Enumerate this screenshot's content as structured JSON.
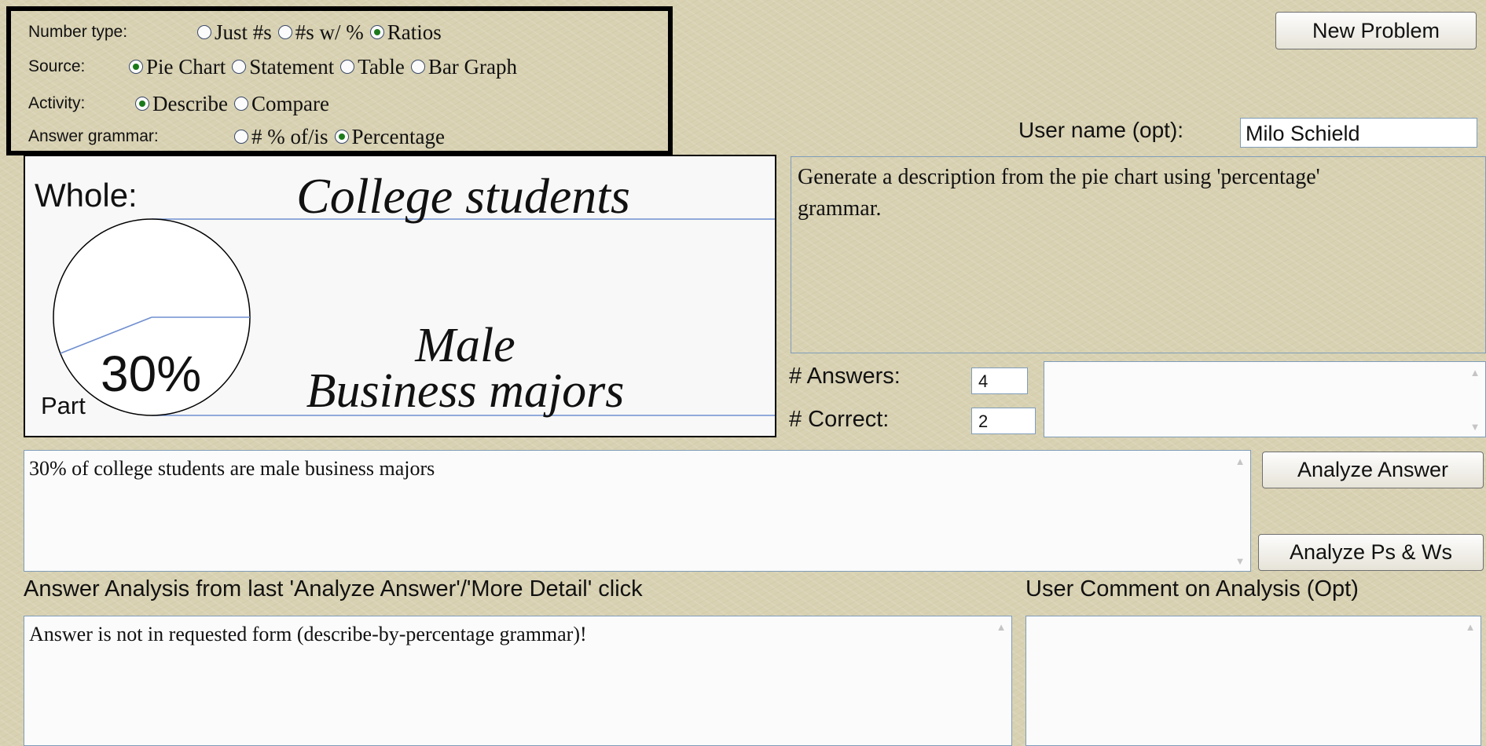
{
  "options": {
    "number_type": {
      "label": "Number type:",
      "options": [
        {
          "label": "Just #s",
          "selected": false
        },
        {
          "label": "#s w/ %",
          "selected": false
        },
        {
          "label": "Ratios",
          "selected": true
        }
      ]
    },
    "source": {
      "label": "Source:",
      "options": [
        {
          "label": "Pie Chart",
          "selected": true
        },
        {
          "label": "Statement",
          "selected": false
        },
        {
          "label": "Table",
          "selected": false
        },
        {
          "label": "Bar Graph",
          "selected": false
        }
      ]
    },
    "activity": {
      "label": "Activity:",
      "options": [
        {
          "label": "Describe",
          "selected": true
        },
        {
          "label": "Compare",
          "selected": false
        }
      ]
    },
    "answer_grammar": {
      "label": "Answer grammar:",
      "options": [
        {
          "label": "# % of/is",
          "selected": false
        },
        {
          "label": "Percentage",
          "selected": true
        }
      ]
    }
  },
  "buttons": {
    "new_problem": "New Problem",
    "analyze_answer": "Analyze Answer",
    "analyze_ps_ws": "Analyze Ps & Ws"
  },
  "user_name": {
    "label": "User name (opt):",
    "value": "Milo Schield"
  },
  "pie_panel": {
    "whole_label": "Whole:",
    "whole_text": "College students",
    "part_label": "Part",
    "percent": "30%",
    "part_fraction": 0.3,
    "part_text_line1": "Male",
    "part_text_line2": "Business majors"
  },
  "instructions": "Generate a description from the pie chart using 'percentage' grammar.",
  "stats": {
    "answers_label": "# Answers:",
    "answers_value": "4",
    "correct_label": "# Correct:",
    "correct_value": "2"
  },
  "answer_text": "30% of college students are male business majors",
  "analysis": {
    "heading": "Answer Analysis from last 'Analyze Answer'/'More Detail' click",
    "text": "Answer is not in requested form (describe-by-percentage grammar)!"
  },
  "comment": {
    "heading": "User Comment on Analysis (Opt)",
    "text": ""
  },
  "colors": {
    "line_blue": "#6f8fd0",
    "radio_green": "#1a7a1a"
  }
}
